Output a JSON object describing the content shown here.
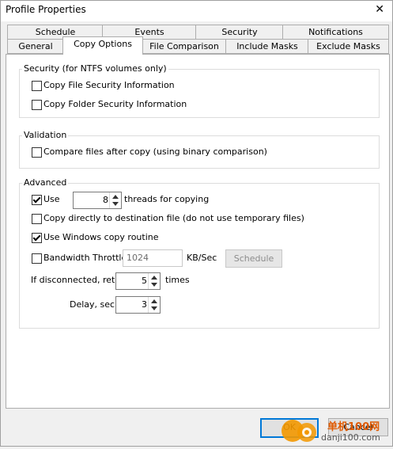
{
  "window": {
    "title": "Profile Properties",
    "close_glyph": "✕"
  },
  "tabs": {
    "row_back": [
      "Schedule",
      "Events",
      "Security",
      "Notifications"
    ],
    "row_front": [
      "General",
      "Copy Options",
      "File Comparison",
      "Include Masks",
      "Exclude Masks"
    ],
    "active": "Copy Options"
  },
  "security_group": {
    "label": "Security (for NTFS volumes only)",
    "copy_file_security": {
      "label": "Copy File Security Information",
      "checked": false
    },
    "copy_folder_security": {
      "label": "Copy Folder Security Information",
      "checked": false
    }
  },
  "validation_group": {
    "label": "Validation",
    "compare_after_copy": {
      "label": "Compare files after copy (using binary comparison)",
      "checked": false
    }
  },
  "advanced_group": {
    "label": "Advanced",
    "use_threads": {
      "label": "Use",
      "checked": true,
      "value": "8",
      "suffix": "threads for copying"
    },
    "copy_directly": {
      "label": "Copy directly to destination file (do not use temporary files)",
      "checked": false
    },
    "use_windows_copy": {
      "label": "Use Windows copy routine",
      "checked": true
    },
    "bandwidth_throttle": {
      "label": "Bandwidth Throttle",
      "checked": false,
      "value": "1024",
      "unit": "KB/Sec",
      "schedule_label": "Schedule"
    },
    "retry": {
      "label": "If disconnected, retry",
      "value": "5",
      "suffix": "times"
    },
    "delay": {
      "label": "Delay, sec",
      "value": "3"
    }
  },
  "footer": {
    "ok_label": "OK",
    "cancel_label": "Cancel"
  },
  "watermark": {
    "brand": "单机100网",
    "domain": "danji100.com"
  }
}
